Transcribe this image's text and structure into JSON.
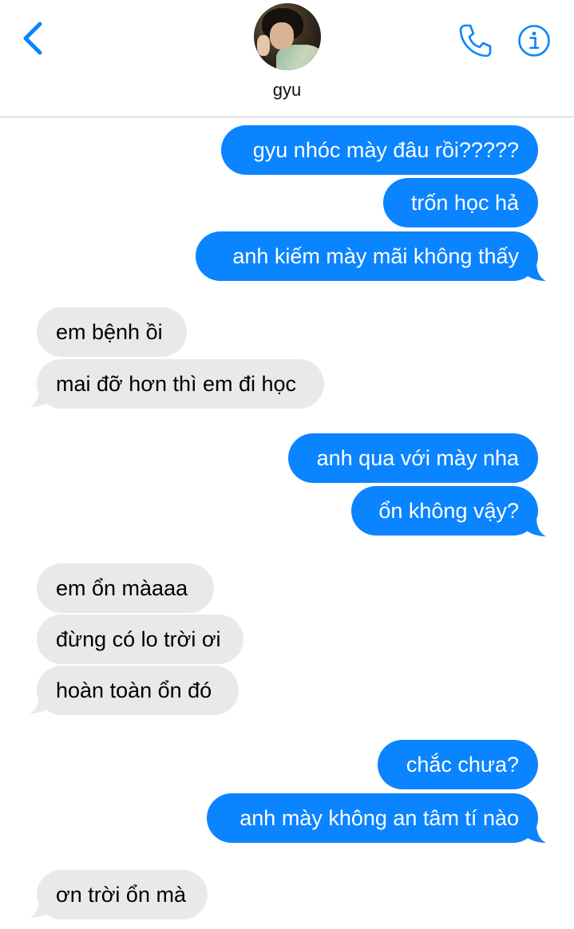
{
  "header": {
    "contact_name": "gyu",
    "accent_color": "#0b84ff"
  },
  "icons": {
    "back": "chevron-left-icon",
    "phone": "phone-icon",
    "info": "info-icon"
  },
  "colors": {
    "sent_bubble": "#0b84ff",
    "received_bubble": "#e9e9eb"
  },
  "messages": [
    {
      "from": "me",
      "text": "gyu nhóc mày đâu rồi?????"
    },
    {
      "from": "me",
      "text": "trốn học hả"
    },
    {
      "from": "me",
      "text": "anh kiếm mày mãi không thấy"
    },
    {
      "from": "them",
      "text": "em bệnh ồi"
    },
    {
      "from": "them",
      "text": "mai đỡ hơn thì em đi học"
    },
    {
      "from": "me",
      "text": "anh qua với mày nha"
    },
    {
      "from": "me",
      "text": "ổn không vậy?"
    },
    {
      "from": "them",
      "text": "em ổn màaaa"
    },
    {
      "from": "them",
      "text": "đừng có lo trời ơi"
    },
    {
      "from": "them",
      "text": "hoàn toàn ổn đó"
    },
    {
      "from": "me",
      "text": "chắc chưa?"
    },
    {
      "from": "me",
      "text": "anh mày không an tâm tí nào"
    },
    {
      "from": "them",
      "text": "ơn trời ổn mà"
    }
  ]
}
